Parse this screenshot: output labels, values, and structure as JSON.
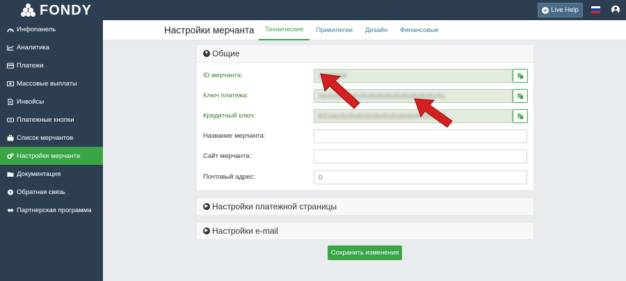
{
  "app": {
    "logo_text": "FONDY"
  },
  "topbar": {
    "live_help_label": "Live Help"
  },
  "sidebar": {
    "items": [
      {
        "label": "Инфопанель",
        "icon": "dashboard-icon"
      },
      {
        "label": "Аналитика",
        "icon": "chart-line-icon"
      },
      {
        "label": "Платежи",
        "icon": "credit-card-icon"
      },
      {
        "label": "Массовые выплаты",
        "icon": "money-icon"
      },
      {
        "label": "Инвойсы",
        "icon": "file-icon"
      },
      {
        "label": "Платежные кнопки",
        "icon": "button-icon"
      },
      {
        "label": "Список мерчантов",
        "icon": "briefcase-icon"
      },
      {
        "label": "Настройки мерчанта",
        "icon": "gears-icon",
        "active": true
      },
      {
        "label": "Документация",
        "icon": "folder-icon"
      },
      {
        "label": "Обратная связь",
        "icon": "question-icon"
      },
      {
        "label": "Партнерская программа",
        "icon": "handshake-icon"
      }
    ]
  },
  "header": {
    "title": "Настройки мерчанта",
    "tabs": [
      {
        "label": "Технические",
        "active": true
      },
      {
        "label": "Привилегии"
      },
      {
        "label": "Дизайн"
      },
      {
        "label": "Финансовые"
      }
    ]
  },
  "general": {
    "title": "Общие",
    "merchant_id": {
      "label": "ID мерчанта:",
      "value": "1400000"
    },
    "payment_key": {
      "label": "Ключ платежа:",
      "value": "HxXxXxXxXxXxXxXxXxXxXxXxXxXxXx"
    },
    "credit_key": {
      "label": "Кредитный ключ:",
      "value": "KCxXxXxXxXxXxXxXxXxXxXxXxXxXxX"
    },
    "merchant_name": {
      "label": "Название мерчанта:",
      "value": ""
    },
    "merchant_site": {
      "label": "Сайт мерчанта:",
      "value": ""
    },
    "postal_address": {
      "label": "Почтовый адрес:",
      "value": "0"
    }
  },
  "payment_page": {
    "title": "Настройки платежной страницы"
  },
  "email_settings": {
    "title": "Настройки e-mail"
  },
  "save_label": "Сохранить изменения",
  "colors": {
    "accent": "#3aa545",
    "sidebar": "#2d3e50",
    "annotation_arrow": "#d42020"
  }
}
